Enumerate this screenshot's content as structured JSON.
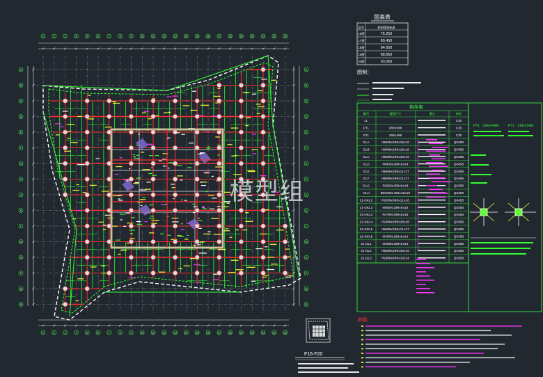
{
  "watermark": "模型组",
  "elevation_table": {
    "title": "层高表",
    "headers": [
      "层号",
      "结构楼面标高"
    ],
    "rows": [
      [
        "16层",
        "76.250"
      ],
      [
        "17层",
        "80.450"
      ],
      [
        "18层",
        "84.650"
      ],
      [
        "19层",
        "88.850"
      ],
      [
        "20层",
        "93.050"
      ]
    ]
  },
  "legend": {
    "title": "图例："
  },
  "member_table": {
    "title": "构件表",
    "headers": [
      "编号",
      "截面尺寸",
      "备注",
      "材料"
    ],
    "rows": [
      [
        "LL",
        "",
        "",
        "C30"
      ],
      [
        "PTL",
        "200x500",
        "",
        "C30"
      ],
      [
        "PTL",
        "200x400",
        "",
        "C30"
      ],
      [
        "GLA",
        "HN500x200x10x16",
        "",
        "Q345B"
      ],
      [
        "GLB",
        "HN500x200x10x16",
        "",
        "Q345B"
      ],
      [
        "GLC",
        "HN500x200x10x16",
        "",
        "Q345B"
      ],
      [
        "GLD",
        "HN450x200x9x14",
        "",
        "Q345B"
      ],
      [
        "GLE",
        "HN600x200x11x17",
        "",
        "Q345B"
      ],
      [
        "GLF",
        "HN600x200x11x17",
        "",
        "Q345B"
      ],
      [
        "GLG",
        "PG650x250x8x20",
        "",
        "Q345B"
      ],
      [
        "GLH",
        "BOX200x450x10x10",
        "",
        "Q345B"
      ],
      [
        "21-GKL1",
        "PG650x300x11x16",
        "",
        "Q345B"
      ],
      [
        "21-GKL2",
        "HN550x200x9x16",
        "",
        "Q345B"
      ],
      [
        "21-GKL3",
        "PG700x300x8x18",
        "",
        "Q345B"
      ],
      [
        "21-GKL4",
        "PG900x300x10x20",
        "",
        "Q345B"
      ],
      [
        "21-GKL5",
        "HN600x200x11x17",
        "",
        "Q345B"
      ],
      [
        "21-GKL6",
        "HN450x200x9x14",
        "",
        "Q345B"
      ],
      [
        "21-GL1",
        "HN450x200x9x14",
        "",
        "Q345B"
      ],
      [
        "21-GL2",
        "HN500x200x10x16",
        "",
        "Q345B"
      ],
      [
        "21-GL3",
        "PG800x400x14x24",
        "",
        "Q345B"
      ]
    ]
  },
  "side_notes": [
    "PTL 200x400",
    "PTL 200x500"
  ],
  "notes": {
    "title": "说明："
  },
  "plan_title": "F16-F20",
  "axis_labels_x": [
    "1",
    "2",
    "3",
    "4",
    "5",
    "6",
    "7",
    "8",
    "9",
    "10",
    "11",
    "12",
    "13",
    "14",
    "15",
    "16",
    "17",
    "18",
    "19",
    "20",
    "21",
    "22",
    "23"
  ],
  "axis_labels_y": [
    "A",
    "B",
    "C",
    "D",
    "E",
    "F",
    "G",
    "H",
    "J",
    "K",
    "L",
    "M",
    "N",
    "P",
    "Q",
    "R"
  ],
  "colors": {
    "background": "#212830",
    "beam_red": "#ff3030",
    "secondary_green": "#33ff33",
    "dimension_yellow": "#ffff33",
    "core_khaki": "#b8b07a",
    "table_frame": "#40ff40",
    "magenta": "#ff33ff",
    "white": "#ffffff"
  }
}
